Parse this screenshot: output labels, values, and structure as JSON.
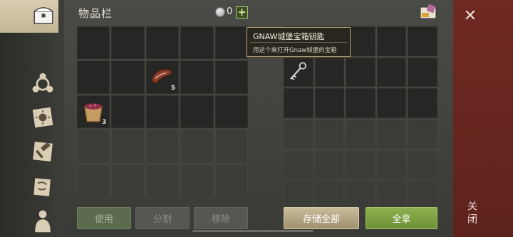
{
  "inventory": {
    "title": "物品栏",
    "coins": "0",
    "add_label": "+",
    "items": [
      {
        "name": "meat",
        "count": "5"
      },
      {
        "name": "berry-bowl",
        "count": "3"
      }
    ],
    "buttons": {
      "use": "使用",
      "split": "分割",
      "remove": "移除"
    }
  },
  "chest": {
    "buttons": {
      "store_all": "存储全部",
      "take_all": "全拿"
    }
  },
  "tooltip": {
    "title": "GNAW城堡宝箱钥匙",
    "description": "用这个来打开Gnaw城堡的宝箱"
  },
  "close": {
    "x": "✕",
    "label": "关闭"
  },
  "colors": {
    "close_panel": "#6f2a22",
    "take_all": "#7fa444",
    "store_all": "#b8aa86"
  }
}
